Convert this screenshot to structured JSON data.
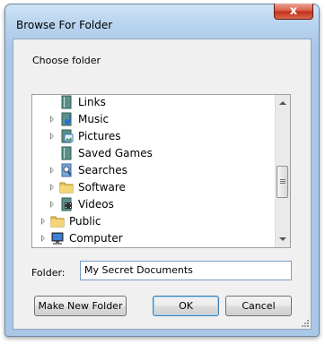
{
  "window": {
    "title": "Browse For Folder",
    "close_glyph": "x"
  },
  "dialog": {
    "prompt": "Choose folder",
    "tree": {
      "items": [
        {
          "label": "Links",
          "icon": "links-folder-icon",
          "expandable": false
        },
        {
          "label": "Music",
          "icon": "music-folder-icon",
          "expandable": true
        },
        {
          "label": "Pictures",
          "icon": "pictures-folder-icon",
          "expandable": true
        },
        {
          "label": "Saved Games",
          "icon": "saved-games-folder-icon",
          "expandable": false
        },
        {
          "label": "Searches",
          "icon": "searches-folder-icon",
          "expandable": true
        },
        {
          "label": "Software",
          "icon": "folder-icon",
          "expandable": true
        },
        {
          "label": "Videos",
          "icon": "videos-folder-icon",
          "expandable": true
        },
        {
          "label": "Public",
          "icon": "public-folder-icon",
          "expandable": true
        },
        {
          "label": "Computer",
          "icon": "computer-icon",
          "expandable": true
        }
      ]
    },
    "folder_label": "Folder:",
    "folder_value": "My Secret Documents",
    "buttons": {
      "make_new_folder": "Make New Folder",
      "ok": "OK",
      "cancel": "Cancel"
    }
  },
  "colors": {
    "title_bar": "#b9d4ef",
    "close_button": "#c3301c",
    "dialog_background": "#f0f0f0",
    "default_button_border": "#3c7fb1"
  }
}
